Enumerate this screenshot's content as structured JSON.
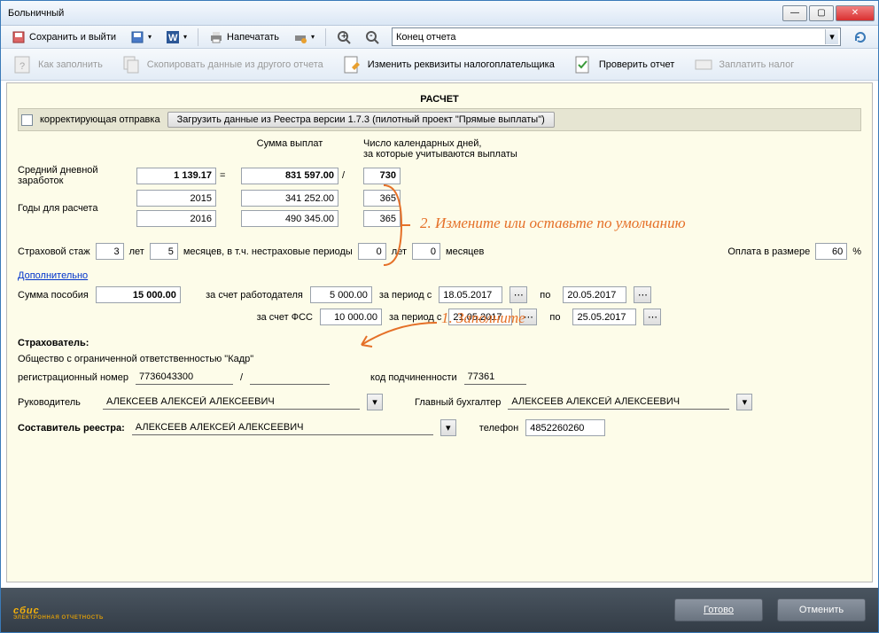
{
  "window": {
    "title": "Больничный"
  },
  "toolbar1": {
    "save_exit": "Сохранить и выйти",
    "print": "Напечатать",
    "combo_value": "Конец отчета"
  },
  "toolbar2": {
    "how_fill": "Как заполнить",
    "copy_data": "Скопировать данные из другого отчета",
    "change_req": "Изменить реквизиты налогоплательщика",
    "check_report": "Проверить отчет",
    "pay_tax": "Заплатить налог"
  },
  "annotations": {
    "step1": "1. Заполните",
    "step2": "2. Измените или оставьте по умолчанию"
  },
  "calc": {
    "section_title": "РАСЧЕТ",
    "correction_label": "корректирующая отправка",
    "load_btn": "Загрузить данные из Реестра версии 1.7.3 (пилотный проект \"Прямые выплаты\")",
    "sum_payments_header": "Сумма выплат",
    "days_header_l1": "Число календарных дней,",
    "days_header_l2": "за которые учитываются выплаты",
    "avg_daily_label": "Средний дневной заработок",
    "avg_daily_value": "1 139.17",
    "total_sum": "831 597.00",
    "total_days": "730",
    "years_label": "Годы для расчета",
    "year1": "2015",
    "year1_sum": "341 252.00",
    "year1_days": "365",
    "year2": "2016",
    "year2_sum": "490 345.00",
    "year2_days": "365",
    "stazh_label": "Страховой стаж",
    "stazh_years": "3",
    "years_word": "лет",
    "stazh_months": "5",
    "months_label": "месяцев, в т.ч. нестраховые периоды",
    "nonins_years": "0",
    "nonins_months": "0",
    "months_word": "месяцев",
    "pay_rate_label": "Оплата в размере",
    "pay_rate": "60",
    "percent": "%",
    "additional_link": "Дополнительно",
    "benefit_sum_label": "Сумма пособия",
    "benefit_sum": "15 000.00",
    "employer_label": "за счет работодателя",
    "employer_sum": "5 000.00",
    "period_from": "за период с",
    "to_word": "по",
    "emp_date_from": "18.05.2017",
    "emp_date_to": "20.05.2017",
    "fss_label": "за счет ФСС",
    "fss_sum": "10 000.00",
    "fss_date_from": "21.05.2017",
    "fss_date_to": "25.05.2017"
  },
  "insurer": {
    "title": "Страхователь:",
    "org_name": "Общество с ограниченной ответственностью \"Кадр\"",
    "reg_num_label": "регистрационный номер",
    "reg_num": "7736043300",
    "sub_code_label": "код подчиненности",
    "sub_code": "77361",
    "head_label": "Руководитель",
    "head_name": "АЛЕКСЕЕВ АЛЕКСЕЙ АЛЕКСЕЕВИЧ",
    "accountant_label": "Главный бухгалтер",
    "accountant_name": "АЛЕКСЕЕВ АЛЕКСЕЙ АЛЕКСЕЕВИЧ",
    "compiler_label": "Составитель реестра:",
    "compiler_name": "АЛЕКСЕЕВ АЛЕКСЕЙ АЛЕКСЕЕВИЧ",
    "phone_label": "телефон",
    "phone": "4852260260"
  },
  "footer": {
    "logo": "сбис",
    "logo_sub": "ЭЛЕКТРОННАЯ ОТЧЕТНОСТЬ",
    "ok": "Готово",
    "cancel": "Отменить"
  }
}
